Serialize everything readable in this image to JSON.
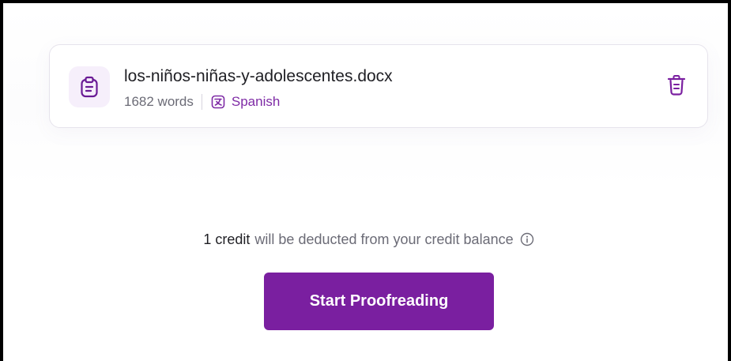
{
  "file": {
    "name": "los-niños-niñas-y-adolescentes.docx",
    "word_count": "1682 words",
    "language": "Spanish",
    "file_icon": "clipboard-document-icon",
    "language_icon": "translate-icon",
    "delete_icon": "trash-icon"
  },
  "credit_notice": {
    "amount": "1 credit",
    "text": "will be deducted from your credit balance",
    "info_icon": "info-icon"
  },
  "actions": {
    "start_label": "Start Proofreading"
  },
  "colors": {
    "accent": "#7a1fa0",
    "language_text": "#7e2aa5",
    "icon_bg": "#f6effb",
    "muted_text": "#6b6b76"
  }
}
